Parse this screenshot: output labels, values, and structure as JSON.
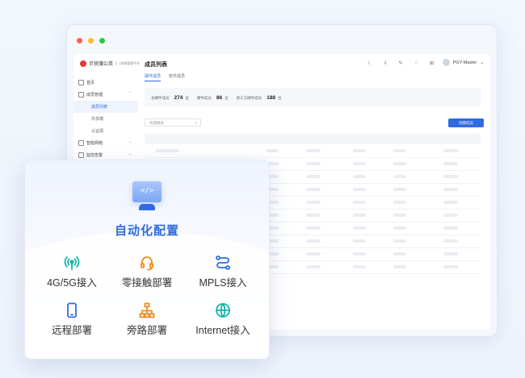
{
  "app": {
    "logo_text": "贝锐蒲公英",
    "logo_sub": "| 网络管理平台",
    "page_title": "成员列表"
  },
  "user": {
    "name": "PGY-Master"
  },
  "sidebar": {
    "items": [
      {
        "label": "首页"
      },
      {
        "label": "成员管理"
      },
      {
        "label": "成员列表"
      },
      {
        "label": "共享端"
      },
      {
        "label": "认证源"
      },
      {
        "label": "智能网络"
      },
      {
        "label": "监控告警"
      }
    ]
  },
  "tabs": [
    {
      "label": "硬件成员"
    },
    {
      "label": "软件成员"
    }
  ],
  "stats": [
    {
      "label": "总硬件成员",
      "value": "274",
      "unit": "台"
    },
    {
      "label": "硬件成员",
      "value": "86",
      "unit": "台"
    },
    {
      "label": "第三方硬件成员",
      "value": "188",
      "unit": "台"
    }
  ],
  "search": {
    "placeholder": "快速搜索"
  },
  "new_button": {
    "label": "创建成员"
  },
  "card": {
    "title": "自动化配置",
    "features": [
      {
        "label": "4G/5G接入",
        "icon": "signal-tower-icon",
        "color": "#14b3a8"
      },
      {
        "label": "零接触部署",
        "icon": "headset-icon",
        "color": "#f08c1c"
      },
      {
        "label": "MPLS接入",
        "icon": "route-icon",
        "color": "#2f6bdf"
      },
      {
        "label": "远程部署",
        "icon": "smartphone-icon",
        "color": "#2f6bdf"
      },
      {
        "label": "旁路部署",
        "icon": "network-topology-icon",
        "color": "#f08c1c"
      },
      {
        "label": "Internet接入",
        "icon": "globe-icon",
        "color": "#14b3a8"
      }
    ]
  },
  "colors": {
    "accent": "#2f6bdf",
    "teal": "#14b3a8",
    "orange": "#f08c1c"
  }
}
